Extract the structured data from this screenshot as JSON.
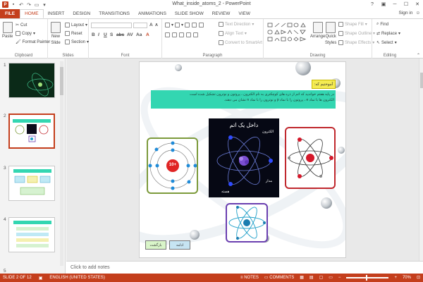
{
  "window": {
    "title": "What_inside_atoms_2 - PowerPoint",
    "help": "?",
    "sign_in": "Sign in"
  },
  "tabs": [
    "FILE",
    "HOME",
    "INSERT",
    "DESIGN",
    "TRANSITIONS",
    "ANIMATIONS",
    "SLIDE SHOW",
    "REVIEW",
    "VIEW"
  ],
  "active_tab": "HOME",
  "ribbon": {
    "clipboard": {
      "label": "Clipboard",
      "paste": "Paste",
      "cut": "Cut",
      "copy": "Copy",
      "format_painter": "Format Painter"
    },
    "slides": {
      "label": "Slides",
      "new_slide_1": "New",
      "new_slide_2": "Slide",
      "layout": "Layout",
      "reset": "Reset",
      "section": "Section"
    },
    "font": {
      "label": "Font"
    },
    "paragraph": {
      "label": "Paragraph",
      "text_direction": "Text Direction",
      "align_text": "Align Text",
      "convert": "Convert to SmartArt"
    },
    "drawing": {
      "label": "Drawing",
      "arrange": "Arrange",
      "quick_styles_1": "Quick",
      "quick_styles_2": "Styles",
      "shape_fill": "Shape Fill",
      "shape_outline": "Shape Outline",
      "shape_effects": "Shape Effects"
    },
    "editing": {
      "label": "Editing",
      "find": "Find",
      "replace": "Replace",
      "select": "Select"
    }
  },
  "thumbnails": [
    "1",
    "2",
    "3",
    "4",
    "5"
  ],
  "slide": {
    "tag": "آموختیم که:",
    "banner_line1": "در پایه هفتم خواندید که اتم از ذره های کوچکتری به نام الکترون ، پروتون و نوترون تشکیل شده است",
    "banner_line2": "الکترون ها با نماد e ، پروتون را با نماد p و نوترون را با نماد n نشان می دهند.",
    "atom_title": "داخل یک اتم",
    "electron_label": "الکترون",
    "nucleus_label": "هسته",
    "orbit_label": "مدار",
    "nucleus_charge": "10+",
    "back_button": "بازگشت",
    "next_button": "ادامه"
  },
  "notes_placeholder": "Click to add notes",
  "status": {
    "slide_info": "SLIDE 2 OF 12",
    "language": "ENGLISH (UNITED STATES)",
    "notes": "NOTES",
    "comments": "COMMENTS",
    "zoom": "70%"
  },
  "colors": {
    "accent": "#c43e1c",
    "banner": "#33d6b1",
    "tag": "#f5ec52"
  }
}
